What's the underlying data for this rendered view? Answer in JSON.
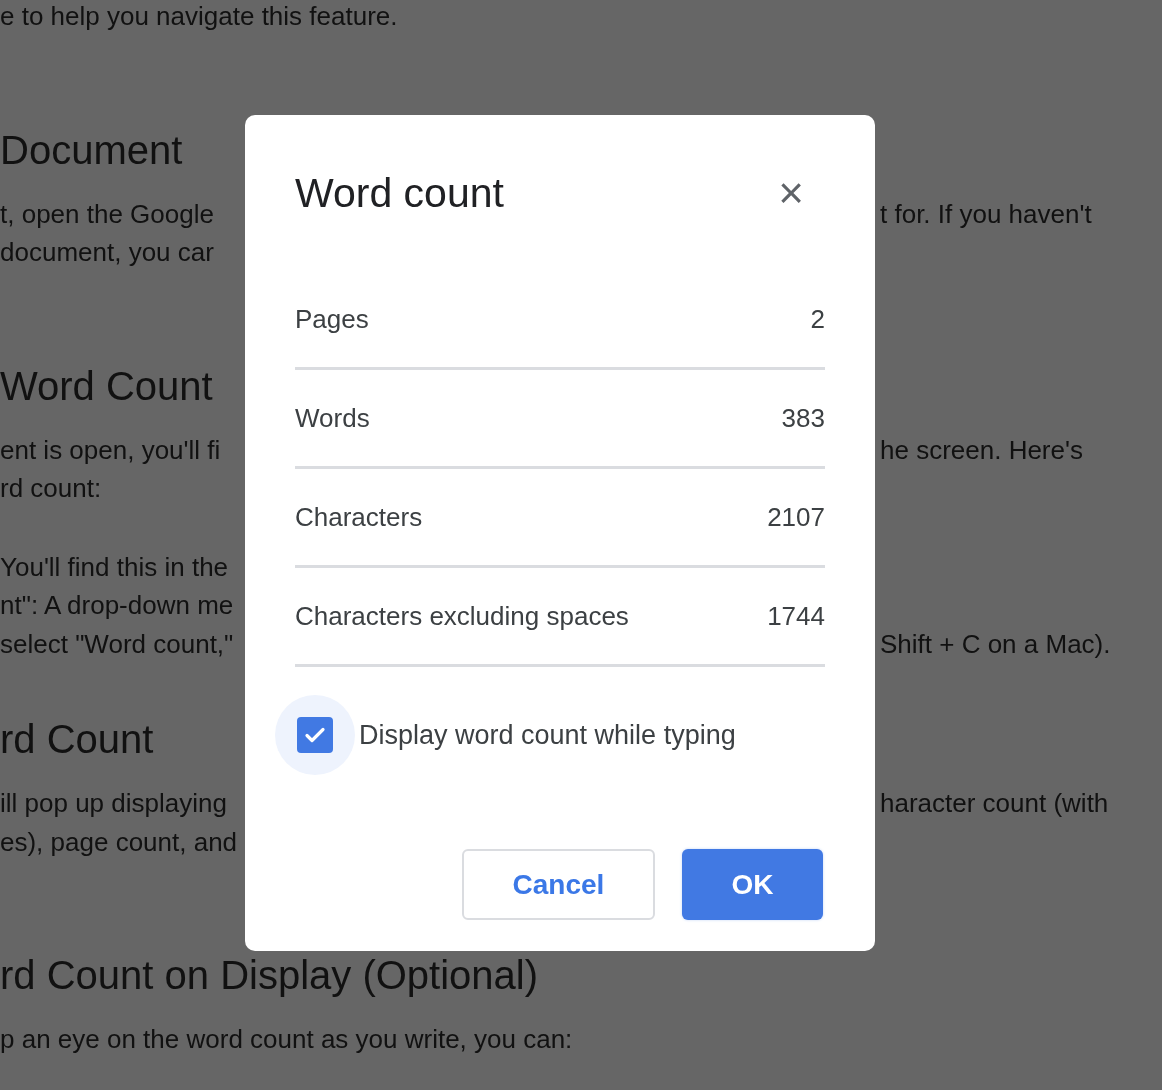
{
  "background": [
    {
      "kind": "paragraph",
      "lines": [
        {
          "left": "e to help you navigate this feature."
        }
      ]
    },
    {
      "kind": "heading",
      "lines": [
        {
          "left": "Document"
        }
      ]
    },
    {
      "kind": "paragraph",
      "lines": [
        {
          "left": "t, open the Google",
          "right": "t for. If you haven't"
        },
        {
          "left": "document, you car"
        }
      ]
    },
    {
      "kind": "heading",
      "lines": [
        {
          "left": "Word Count"
        }
      ]
    },
    {
      "kind": "paragraph",
      "lines": [
        {
          "left": "ent is open, you'll fi",
          "right": "he screen. Here's"
        },
        {
          "left": "rd count:"
        }
      ]
    },
    {
      "kind": "list",
      "lines": [
        {
          "left": "You'll find this in the"
        },
        {
          "left": "nt\": A drop-down me"
        },
        {
          "left": "select \"Word count,\"",
          "right": "Shift + C on a Mac)."
        }
      ]
    },
    {
      "kind": "heading",
      "lines": [
        {
          "left": "rd Count"
        }
      ]
    },
    {
      "kind": "paragraph",
      "lines": [
        {
          "left": "ill pop up displaying",
          "right": "haracter count (with"
        },
        {
          "left": "es), page count, and"
        }
      ]
    },
    {
      "kind": "heading",
      "lines": [
        {
          "left": "rd Count on Display (Optional)"
        }
      ]
    },
    {
      "kind": "paragraph",
      "lines": [
        {
          "left": "p an eye on the word count as you write, you can:"
        }
      ]
    }
  ],
  "dialog": {
    "title": "Word count",
    "close": "×",
    "stats": [
      {
        "label": "Pages",
        "value": "2"
      },
      {
        "label": "Words",
        "value": "383"
      },
      {
        "label": "Characters",
        "value": "2107"
      },
      {
        "label": "Characters excluding spaces",
        "value": "1744"
      }
    ],
    "checkbox": {
      "label": "Display word count while typing",
      "checked": true
    },
    "buttons": [
      {
        "label": "Cancel",
        "kind": "secondary"
      },
      {
        "label": "OK",
        "kind": "primary"
      }
    ]
  }
}
